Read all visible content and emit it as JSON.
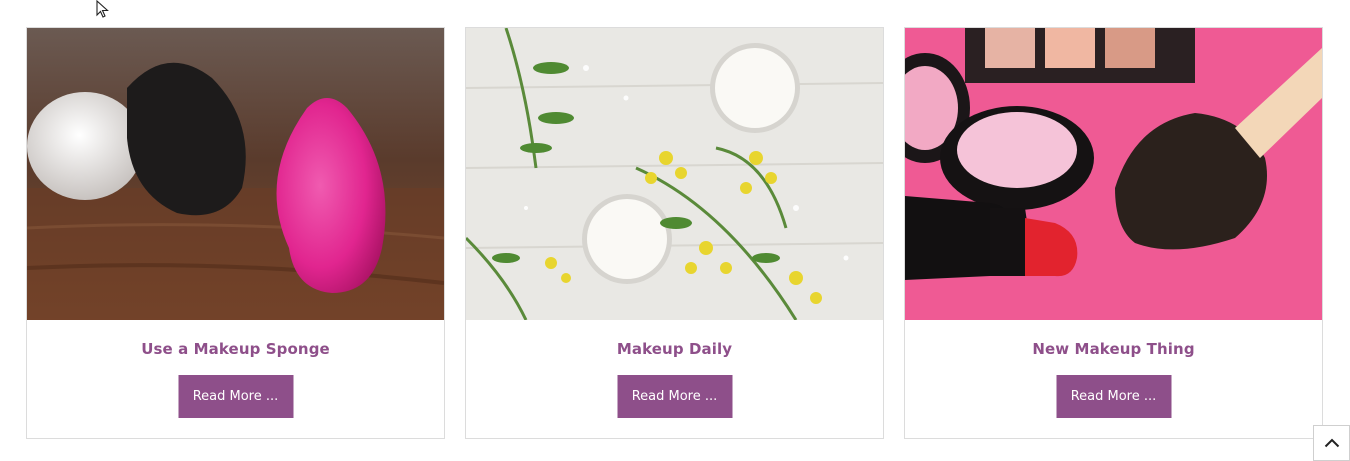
{
  "cards": [
    {
      "title": "Use a Makeup Sponge",
      "button": "Read More ...",
      "image_icon": "makeup-sponge-photo"
    },
    {
      "title": "Makeup Daily",
      "button": "Read More ...",
      "image_icon": "cream-and-flowers-photo"
    },
    {
      "title": "New Makeup Thing",
      "button": "Read More ...",
      "image_icon": "lipstick-and-brush-photo"
    }
  ],
  "colors": {
    "accent": "#8e4f8a",
    "border": "#dcdcdc"
  },
  "scroll_top_icon": "chevron-up-icon"
}
